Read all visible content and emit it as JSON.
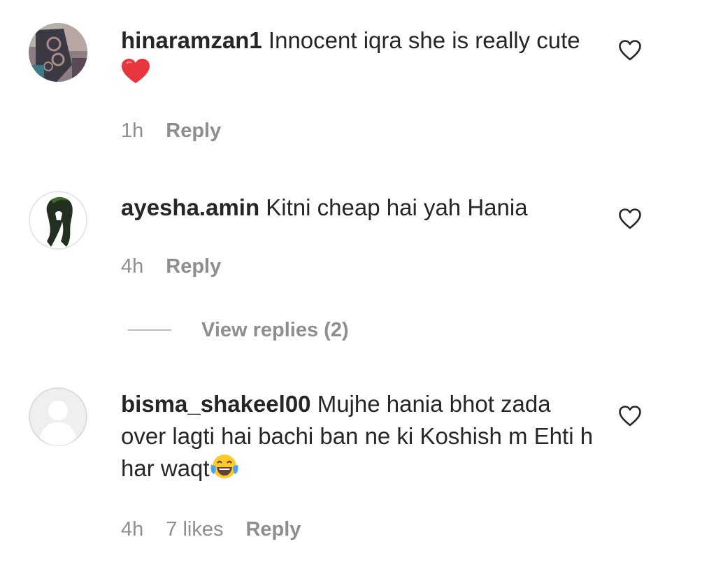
{
  "comments": [
    {
      "username": "hinaramzan1",
      "text": "Innocent iqra she is really cute",
      "emoji": "red-heart",
      "time": "1h",
      "likes": "",
      "reply_label": "Reply"
    },
    {
      "username": "ayesha.amin",
      "text": "Kitni cheap hai yah Hania",
      "time": "4h",
      "likes": "",
      "reply_label": "Reply",
      "view_replies_label": "View replies (2)"
    },
    {
      "username": "bisma_shakeel00",
      "text": "Mujhe hania bhot zada over lagti hai bachi ban ne ki Koshish m Ehti h har waqt",
      "emoji": "face-with-tears-of-joy",
      "time": "4h",
      "likes": "7 likes",
      "reply_label": "Reply"
    }
  ],
  "icons": {
    "like": "heart-outline-icon"
  },
  "colors": {
    "primary_text": "#262626",
    "secondary_text": "#8e8e8e",
    "reply_line": "#bdbdbd",
    "heart_emoji": "#e8363f"
  }
}
